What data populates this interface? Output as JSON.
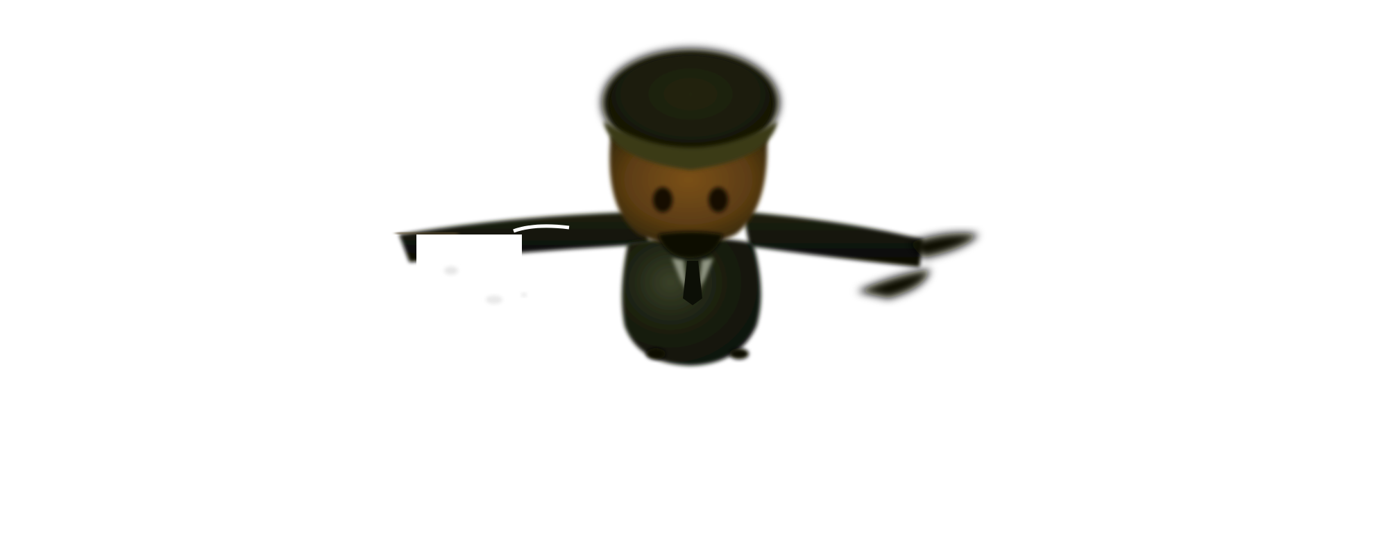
{
  "scene": {
    "background_color": "#ffffff",
    "subject": "cartoon-character-t-pose",
    "colors": {
      "hat": "#1d1f0a",
      "hat_rim_highlight": "#4a4a1f",
      "face_skin": "#6a4518",
      "face_shadow": "#3b2a0c",
      "eyes": "#130c05",
      "mouth": "#0e1106",
      "suit": "#181c0e",
      "suit_highlight": "#3a4129",
      "collar": "#8f9482",
      "tie": "#0c0f06",
      "arm": "#111308",
      "glove_white": "#ffffff"
    }
  }
}
